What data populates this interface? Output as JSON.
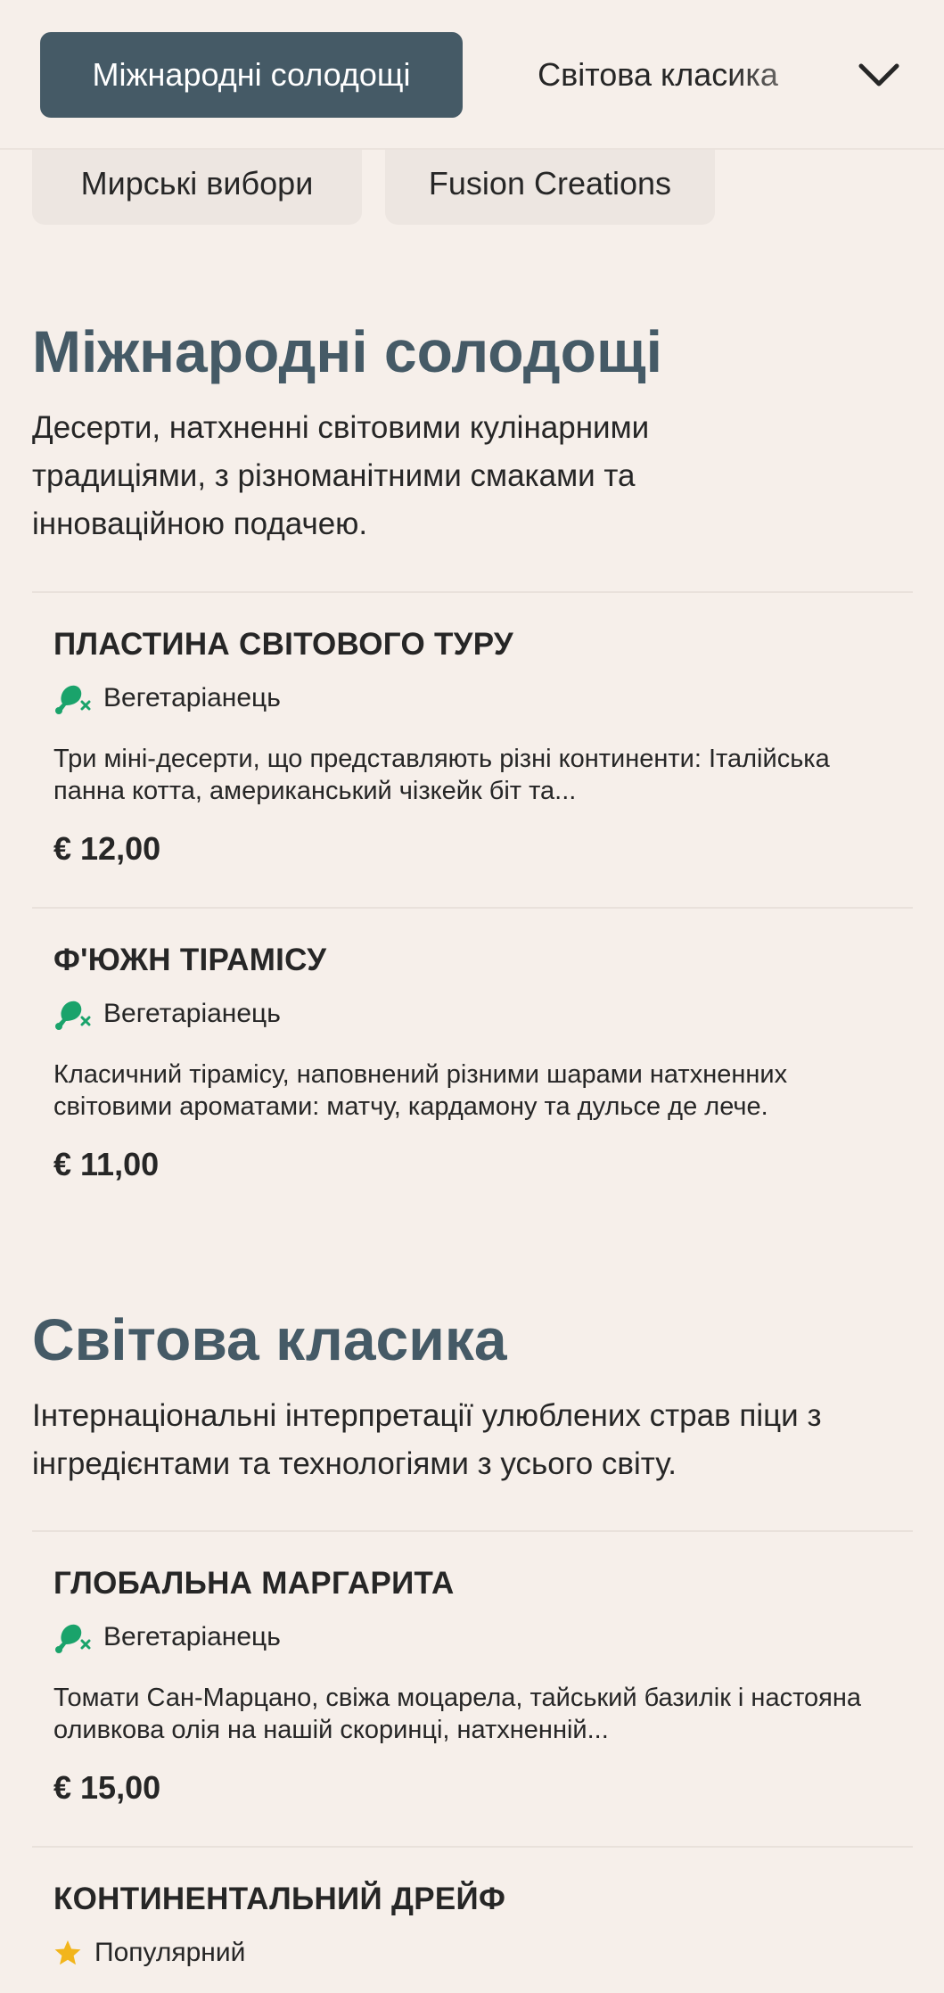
{
  "nav": {
    "active_tab": "Міжнародні солодощі",
    "next_tab": "Світова класика",
    "more_icon": "chevron-down-icon"
  },
  "pills": [
    "Мирські вибори",
    "Fusion Creations"
  ],
  "sections": [
    {
      "title": "Міжнародні солодощі",
      "description": "Десерти, натхненні світовими кулінарними традиціями, з різноманітними смаками та інноваційною подачею.",
      "items": [
        {
          "name": "ПЛАСТИНА СВІТОВОГО ТУРУ",
          "tag": "Вегетаріанець",
          "tag_icon": "vegetarian-drumstick-icon",
          "description": "Три міні-десерти, що представляють різні континенти: Італійська панна котта, американський чізкейк біт та...",
          "price": "€ 12,00"
        },
        {
          "name": "Ф'ЮЖН ТІРАМІСУ",
          "tag": "Вегетаріанець",
          "tag_icon": "vegetarian-drumstick-icon",
          "description": "Класичний тірамісу, наповнений різними шарами натхненних світовими ароматами: матчу, кардамону та дульсе де лече.",
          "price": "€ 11,00"
        }
      ]
    },
    {
      "title": "Світова класика",
      "description": "Інтернаціональні інтерпретації улюблених страв піци з інгредієнтами та технологіями з усього світу.",
      "items": [
        {
          "name": "ГЛОБАЛЬНА МАРГАРИТА",
          "tag": "Вегетаріанець",
          "tag_icon": "vegetarian-drumstick-icon",
          "description": "Томати Сан-Марцано, свіжа моцарела, тайський базилік і настояна оливкова олія на нашій скоринці, натхненній...",
          "price": "€ 15,00"
        },
        {
          "name": "КОНТИНЕНТАЛЬНИЙ ДРЕЙФ",
          "tag": "Популярний",
          "tag_icon": "star-icon"
        }
      ]
    }
  ],
  "colors": {
    "background": "#f6efea",
    "accent": "#455a66",
    "vegetarian_green": "#1aa36b",
    "star_gold": "#f2b51b"
  }
}
